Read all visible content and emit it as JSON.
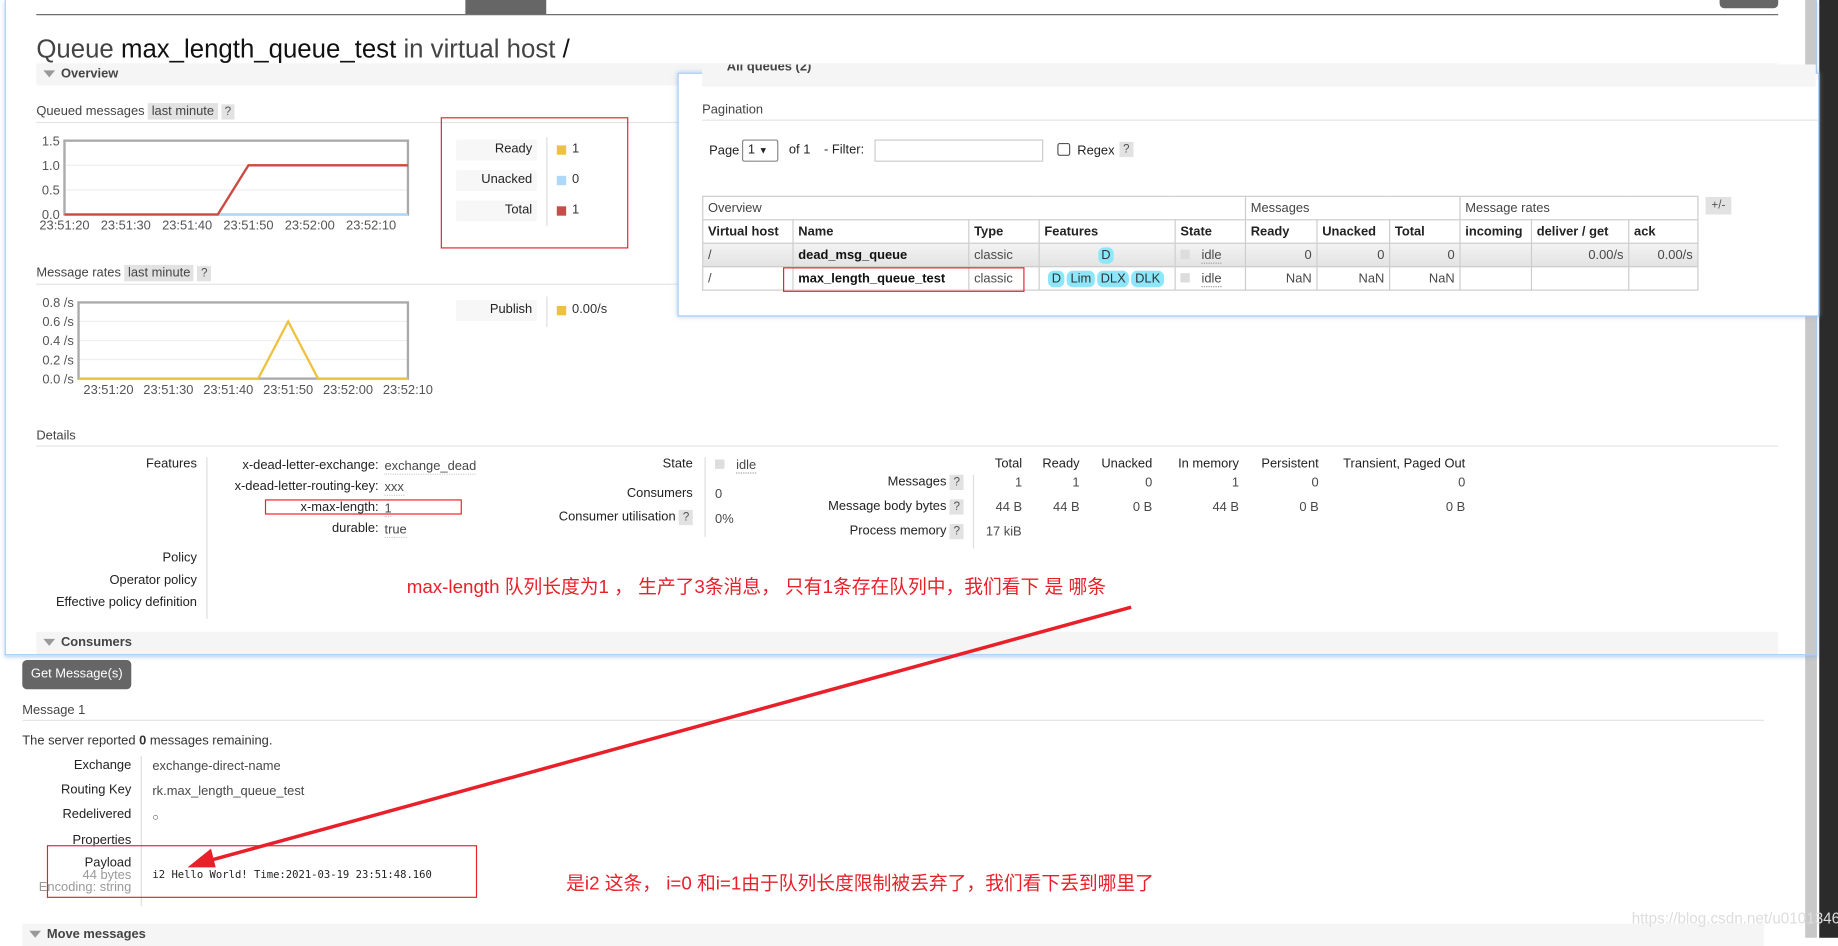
{
  "title": {
    "prefix": "Queue",
    "name": "max_length_queue_test",
    "mid": "in virtual host",
    "vhost": "/"
  },
  "sections": {
    "overview": "Overview",
    "details": "Details",
    "consumers": "Consumers",
    "move": "Move messages",
    "all_queues": "All queues (2)"
  },
  "queued": {
    "label": "Queued messages",
    "range": "last minute",
    "help": "?",
    "legend": [
      {
        "label": "Ready",
        "value": "1",
        "color": "#edc240"
      },
      {
        "label": "Unacked",
        "value": "0",
        "color": "#afd8f8"
      },
      {
        "label": "Total",
        "value": "1",
        "color": "#cb4b4b"
      }
    ]
  },
  "rates": {
    "label": "Message rates",
    "range": "last minute",
    "help": "?",
    "legend": [
      {
        "label": "Publish",
        "value": "0.00/s",
        "color": "#edc240"
      }
    ]
  },
  "chart_data": [
    {
      "type": "line",
      "title": "Queued messages",
      "ylim": [
        0,
        1.5
      ],
      "yticks": [
        "0.0",
        "0.5",
        "1.0",
        "1.5"
      ],
      "xlim": [
        "23:51:20",
        "23:52:16"
      ],
      "xticks": [
        "23:51:20",
        "23:51:30",
        "23:51:40",
        "23:51:50",
        "23:52:00",
        "23:52:10"
      ],
      "grid": true,
      "series": [
        {
          "name": "Unacked",
          "color": "#afd8f8",
          "points": [
            [
              "23:51:20",
              0
            ],
            [
              "23:52:16",
              0
            ]
          ]
        },
        {
          "name": "Ready",
          "color": "#edc240",
          "points": [
            [
              "23:51:20",
              0
            ],
            [
              "23:51:45",
              0
            ],
            [
              "23:51:50",
              1
            ],
            [
              "23:52:16",
              1
            ]
          ]
        },
        {
          "name": "Total",
          "color": "#cb4b4b",
          "points": [
            [
              "23:51:20",
              0
            ],
            [
              "23:51:45",
              0
            ],
            [
              "23:51:50",
              1
            ],
            [
              "23:52:16",
              1
            ]
          ]
        }
      ]
    },
    {
      "type": "line",
      "title": "Message rates",
      "ylim": [
        0,
        0.8
      ],
      "yticks": [
        "0.0 /s",
        "0.2 /s",
        "0.4 /s",
        "0.6 /s",
        "0.8 /s"
      ],
      "xlim": [
        "23:51:15",
        "23:52:10"
      ],
      "xticks": [
        "23:51:20",
        "23:51:30",
        "23:51:40",
        "23:51:50",
        "23:52:00",
        "23:52:10"
      ],
      "grid": true,
      "series": [
        {
          "name": "Publish",
          "color": "#edc240",
          "points": [
            [
              "23:51:15",
              0
            ],
            [
              "23:51:45",
              0
            ],
            [
              "23:51:50",
              0.6
            ],
            [
              "23:51:55",
              0
            ],
            [
              "23:52:10",
              0
            ]
          ]
        }
      ]
    }
  ],
  "details": {
    "features_label": "Features",
    "features": [
      {
        "k": "x-dead-letter-exchange:",
        "v": "exchange_dead"
      },
      {
        "k": "x-dead-letter-routing-key:",
        "v": "xxx"
      },
      {
        "k": "x-max-length:",
        "v": "1"
      },
      {
        "k": "durable:",
        "v": "true"
      }
    ],
    "policy": "Policy",
    "operator_policy": "Operator policy",
    "effective_policy": "Effective policy definition",
    "state_label": "State",
    "state": "idle",
    "consumers_label": "Consumers",
    "consumers": "0",
    "util_label": "Consumer utilisation",
    "util": "0%",
    "cols": [
      "Total",
      "Ready",
      "Unacked",
      "In memory",
      "Persistent",
      "Transient, Paged Out"
    ],
    "rows": [
      {
        "label": "Messages",
        "vals": [
          "1",
          "1",
          "0",
          "1",
          "0",
          "0"
        ]
      },
      {
        "label": "Message body bytes",
        "vals": [
          "44 B",
          "44 B",
          "0 B",
          "44 B",
          "0 B",
          "0 B"
        ]
      },
      {
        "label": "Process memory",
        "vals": [
          "17 kiB",
          "",
          "",
          "",
          "",
          ""
        ]
      }
    ]
  },
  "annotation1": "max-length 队列长度为1 ， 生产了3条消息， 只有1条存在队列中，我们看下 是 哪条",
  "annotation2": "是i2 这条， i=0 和i=1由于队列长度限制被丢弃了，我们看下丢到哪里了",
  "get": {
    "button": "Get Message(s)",
    "msg_title": "Message 1",
    "remaining_pre": "The server reported",
    "remaining": "0",
    "remaining_post": "messages remaining.",
    "exchange_label": "Exchange",
    "exchange": "exchange-direct-name",
    "rk_label": "Routing Key",
    "rk": "rk.max_length_queue_test",
    "redelivered_label": "Redelivered",
    "redelivered": "○",
    "properties_label": "Properties",
    "payload_label": "Payload",
    "payload_bytes": "44 bytes",
    "encoding": "Encoding: string",
    "payload": "i2 Hello World! Time:2021-03-19 23:51:48.160"
  },
  "popup": {
    "pagination": "Pagination",
    "page_label": "Page",
    "page": "1",
    "of": "of 1",
    "filter_label": "- Filter:",
    "filter": "",
    "regex": "Regex",
    "help": "?",
    "plusminus": "+/-",
    "groups": [
      "Overview",
      "Messages",
      "Message rates"
    ],
    "headers": [
      "Virtual host",
      "Name",
      "Type",
      "Features",
      "State",
      "Ready",
      "Unacked",
      "Total",
      "incoming",
      "deliver / get",
      "ack"
    ],
    "rows": [
      {
        "vhost": "/",
        "name": "dead_msg_queue",
        "type": "classic",
        "features": [
          "D"
        ],
        "state": "idle",
        "ready": "0",
        "unacked": "0",
        "total": "0",
        "incoming": "",
        "deliver": "0.00/s",
        "ack": "0.00/s"
      },
      {
        "vhost": "/",
        "name": "max_length_queue_test",
        "type": "classic",
        "features": [
          "D",
          "Lim",
          "DLX",
          "DLK"
        ],
        "state": "idle",
        "ready": "NaN",
        "unacked": "NaN",
        "total": "NaN",
        "incoming": "",
        "deliver": "",
        "ack": ""
      }
    ]
  },
  "watermark": "https://blog.csdn.net/u010134642"
}
